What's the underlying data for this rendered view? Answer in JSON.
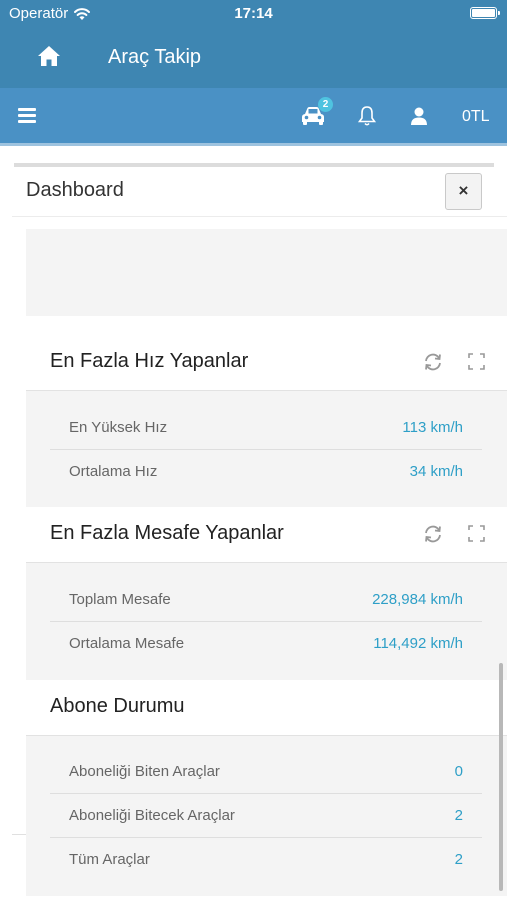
{
  "status_bar": {
    "carrier": "Operatör",
    "time": "17:14"
  },
  "header": {
    "title": "Araç Takip",
    "home_icon": "home-icon"
  },
  "toolbar": {
    "menu_icon": "hamburger-menu-icon",
    "vehicle_badge": "2",
    "balance": "0TL"
  },
  "dashboard": {
    "title": "Dashboard",
    "close_label": "×"
  },
  "speed_panel": {
    "title": "En Fazla Hız Yapanlar",
    "rows": [
      {
        "label": "En Yüksek Hız",
        "value": "113 km/h"
      },
      {
        "label": "Ortalama Hız",
        "value": "34 km/h"
      }
    ]
  },
  "distance_panel": {
    "title": "En Fazla Mesafe Yapanlar",
    "rows": [
      {
        "label": "Toplam Mesafe",
        "value": "228,984 km/h"
      },
      {
        "label": "Ortalama Mesafe",
        "value": "114,492 km/h"
      }
    ]
  },
  "subscription_panel": {
    "title": "Abone Durumu",
    "rows": [
      {
        "label": "Aboneliği Biten Araçlar",
        "value": "0"
      },
      {
        "label": "Aboneliği Bitecek Araçlar",
        "value": "2"
      },
      {
        "label": "Tüm Araçlar",
        "value": "2"
      }
    ]
  },
  "colors": {
    "header": "#3e86b2",
    "toolbar": "#4a91c5",
    "accent_value": "#2e9fc7",
    "badge": "#4fc3e0"
  }
}
